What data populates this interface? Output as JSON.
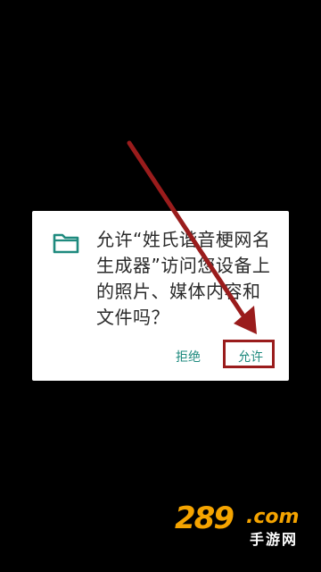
{
  "dialog": {
    "icon": "folder-icon",
    "message": "允许“姓氏谐音梗网名生成器”访问您设备上的照片、媒体内容和文件吗？",
    "deny_label": "拒绝",
    "allow_label": "允许"
  },
  "colors": {
    "background": "#000000",
    "dialog_bg": "#ffffff",
    "accent": "#1e8a7e",
    "annotation": "#9a1c1c",
    "watermark": "#f5a400"
  },
  "watermark": {
    "brand": "289",
    "domain": ".com",
    "subtitle": "手游网"
  }
}
